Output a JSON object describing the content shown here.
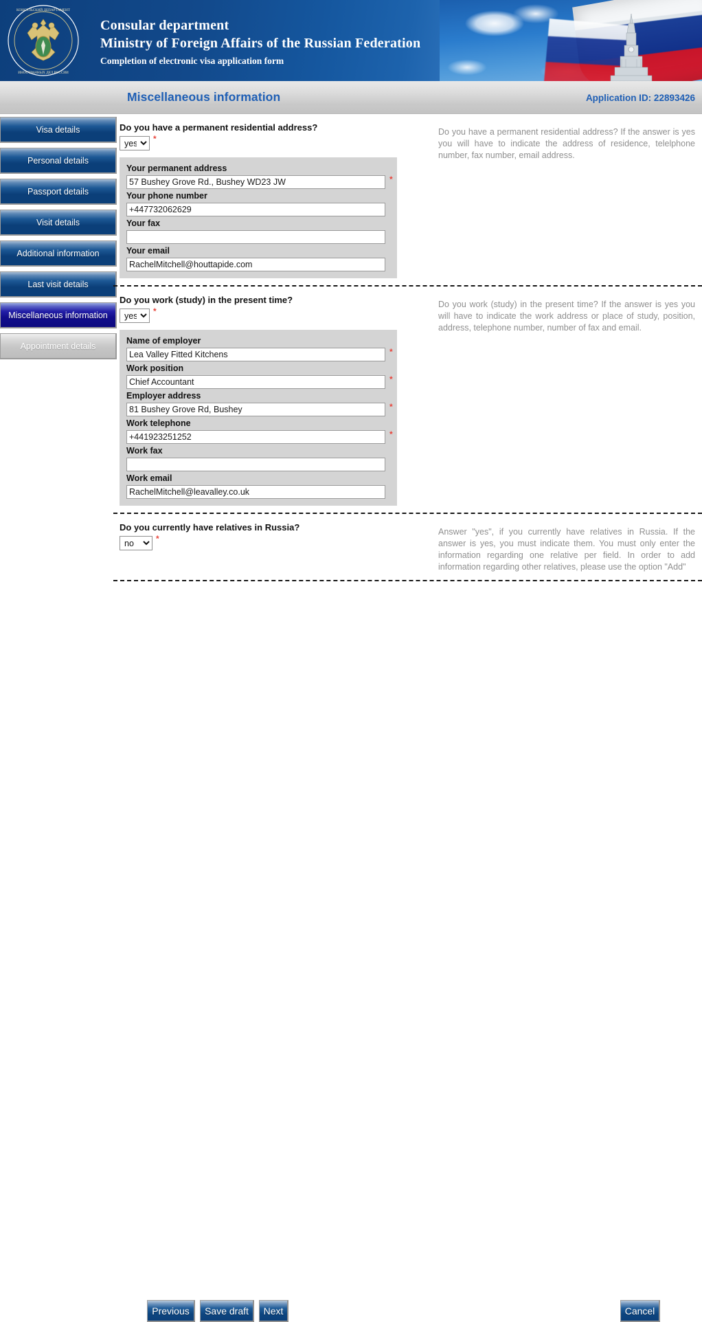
{
  "banner": {
    "title_line1": "Consular department",
    "title_line2": "Ministry of Foreign Affairs of the Russian Federation",
    "subtitle": "Completion of electronic visa application form"
  },
  "titlebar": {
    "page_title": "Miscellaneous information",
    "application_id": "Application ID: 22893426"
  },
  "sidebar": {
    "items": [
      {
        "label": "Visa details",
        "state": "normal"
      },
      {
        "label": "Personal details",
        "state": "normal"
      },
      {
        "label": "Passport details",
        "state": "normal"
      },
      {
        "label": "Visit details",
        "state": "normal"
      },
      {
        "label": "Additional information",
        "state": "normal"
      },
      {
        "label": "Last visit details",
        "state": "normal"
      },
      {
        "label": "Miscellaneous information",
        "state": "active"
      },
      {
        "label": "Appointment details",
        "state": "disabled"
      }
    ]
  },
  "sections": {
    "residence": {
      "question": "Do you have a permanent residential address?",
      "answer": "yes",
      "options": [
        "yes",
        "no"
      ],
      "hint": "Do you have a permanent residential address? If the answer is yes you will have to indicate the address of residence, telelphone number, fax number, email address.",
      "fields": [
        {
          "label": "Your permanent address",
          "value": "57 Bushey Grove Rd., Bushey WD23 JW",
          "required": true
        },
        {
          "label": "Your phone number",
          "value": "+447732062629",
          "required": false
        },
        {
          "label": "Your fax",
          "value": "",
          "required": false
        },
        {
          "label": "Your email",
          "value": "RachelMitchell@houttapide.com",
          "required": false
        }
      ]
    },
    "work": {
      "question": "Do you work (study) in the present time?",
      "answer": "yes",
      "options": [
        "yes",
        "no"
      ],
      "hint": "Do you work (study) in the present time? If the answer is yes you will have to indicate the work address or place of study, position, address, telephone number, number of fax and email.",
      "fields": [
        {
          "label": "Name of employer",
          "value": "Lea Valley Fitted Kitchens",
          "required": true
        },
        {
          "label": "Work position",
          "value": "Chief Accountant",
          "required": true
        },
        {
          "label": "Employer address",
          "value": "81 Bushey Grove Rd, Bushey",
          "required": true
        },
        {
          "label": "Work telephone",
          "value": "+441923251252",
          "required": true
        },
        {
          "label": "Work fax",
          "value": "",
          "required": false
        },
        {
          "label": "Work email",
          "value": "RachelMitchell@leavalley.co.uk",
          "required": false
        }
      ]
    },
    "relatives": {
      "question": "Do you currently have relatives in Russia?",
      "answer": "no",
      "options": [
        "yes",
        "no"
      ],
      "hint": "Answer \"yes\", if you currently have relatives in Russia. If the answer is yes, you must indicate them. You must only enter the information regarding one relative per field. In order to add information regarding other relatives, please use the option \"Add\""
    }
  },
  "buttons": {
    "previous": "Previous",
    "save_draft": "Save draft",
    "next": "Next",
    "cancel": "Cancel"
  },
  "colors": {
    "brand_blue": "#1f5fb5",
    "nav_blue": "#0b3f79",
    "active_nav": "#120d8c",
    "required_red": "#e8453c",
    "field_gray": "#d4d4d4",
    "hint_gray": "#8f8f8f"
  }
}
